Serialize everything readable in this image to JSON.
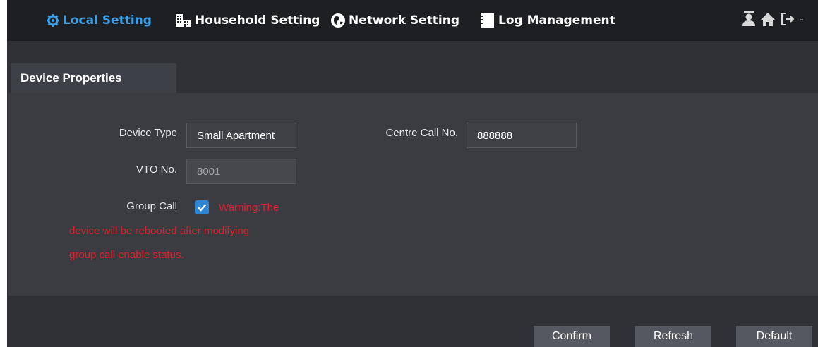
{
  "nav": {
    "items": [
      {
        "label": "Local Setting",
        "icon": "gear-icon",
        "active": true
      },
      {
        "label": "Household Setting",
        "icon": "building-icon",
        "active": false
      },
      {
        "label": "Network Setting",
        "icon": "globe-icon",
        "active": false
      },
      {
        "label": "Log Management",
        "icon": "log-icon",
        "active": false
      }
    ],
    "right_icons": [
      "user-icon",
      "home-icon",
      "logout-icon"
    ],
    "right_dash": "-"
  },
  "tab": {
    "label": "Device Properties"
  },
  "form": {
    "device_type_label": "Device Type",
    "device_type_value": "Small Apartment",
    "centre_call_label": "Centre Call No.",
    "centre_call_value": "888888",
    "vto_label": "VTO No.",
    "vto_value": "8001",
    "group_call_label": "Group Call",
    "group_call_checked": true,
    "warning_line1": "Warning:The",
    "warning_line2": "device will be rebooted after modifying",
    "warning_line3": "group call enable status."
  },
  "buttons": {
    "confirm": "Confirm",
    "refresh": "Refresh",
    "default": "Default"
  },
  "colors": {
    "accent": "#3b9ee6",
    "warning": "#e0202c",
    "checkbox": "#2e86d4"
  }
}
